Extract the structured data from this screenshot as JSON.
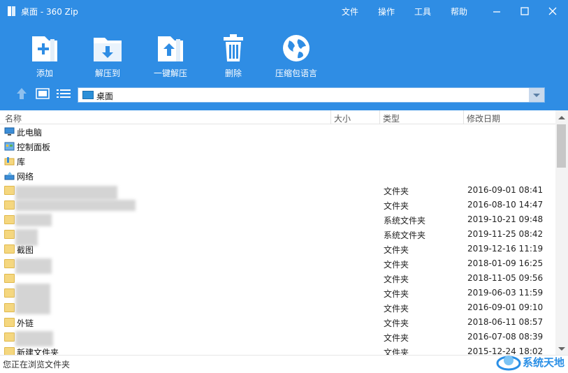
{
  "window": {
    "title": "桌面 - 360 Zip"
  },
  "menu": [
    "文件",
    "操作",
    "工具",
    "帮助"
  ],
  "toolbar": [
    {
      "label": "添加",
      "icon": "add-archive-icon"
    },
    {
      "label": "解压到",
      "icon": "extract-to-icon"
    },
    {
      "label": "一键解压",
      "icon": "one-click-extract-icon"
    },
    {
      "label": "删除",
      "icon": "trash-icon"
    },
    {
      "label": "压缩包语言",
      "icon": "globe-icon"
    }
  ],
  "address": {
    "path": "桌面"
  },
  "columns": {
    "name": "名称",
    "size": "大小",
    "type": "类型",
    "date": "修改日期"
  },
  "rows": [
    {
      "name": "此电脑",
      "type": "",
      "date": "",
      "icon": "computer-icon"
    },
    {
      "name": "控制面板",
      "type": "",
      "date": "",
      "icon": "control-panel-icon"
    },
    {
      "name": "库",
      "type": "",
      "date": "",
      "icon": "library-icon"
    },
    {
      "name": "网络",
      "type": "",
      "date": "",
      "icon": "network-icon"
    },
    {
      "name": "",
      "type": "文件夹",
      "date": "2016-09-01 08:41",
      "icon": "folder-icon"
    },
    {
      "name": "",
      "type": "文件夹",
      "date": "2016-08-10 14:47",
      "icon": "folder-icon"
    },
    {
      "name": "",
      "type": "系统文件夹",
      "date": "2019-10-21 09:48",
      "icon": "folder-icon"
    },
    {
      "name": "",
      "type": "系统文件夹",
      "date": "2019-11-25 08:42",
      "icon": "folder-icon"
    },
    {
      "name": "截图",
      "type": "文件夹",
      "date": "2019-12-16 11:19",
      "icon": "folder-icon"
    },
    {
      "name": "",
      "type": "文件夹",
      "date": "2018-01-09 16:25",
      "icon": "folder-icon"
    },
    {
      "name": "",
      "type": "文件夹",
      "date": "2018-11-05 09:56",
      "icon": "folder-icon"
    },
    {
      "name": "",
      "type": "文件夹",
      "date": "2019-06-03 11:59",
      "icon": "folder-icon"
    },
    {
      "name": "",
      "type": "文件夹",
      "date": "2016-09-01 09:10",
      "icon": "folder-icon"
    },
    {
      "name": "外链",
      "type": "文件夹",
      "date": "2018-06-11 08:57",
      "icon": "folder-icon"
    },
    {
      "name": "",
      "type": "文件夹",
      "date": "2016-07-08 08:39",
      "icon": "folder-icon"
    },
    {
      "name": "新建文件夹",
      "type": "文件夹",
      "date": "2015-12-24 18:02",
      "icon": "folder-icon"
    }
  ],
  "status": {
    "text": "您正在浏览文件夹"
  },
  "watermark": {
    "text": "系统天地"
  },
  "colors": {
    "accent": "#2f8de4",
    "folder": "#f5d77f"
  }
}
